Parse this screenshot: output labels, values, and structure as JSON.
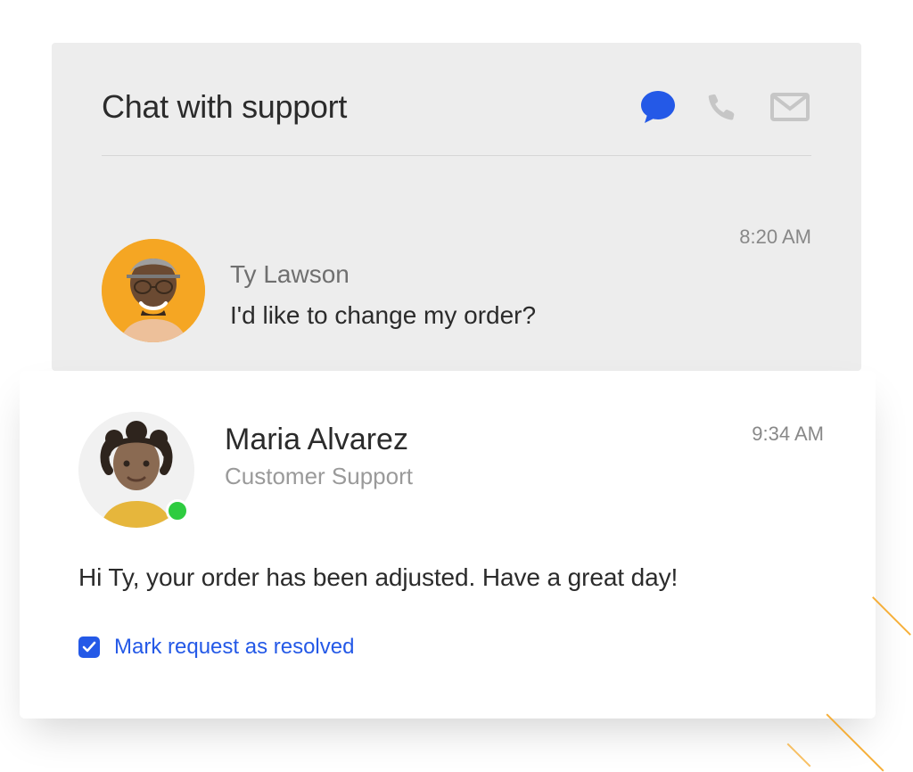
{
  "header": {
    "title": "Chat with support",
    "icons": {
      "chat": {
        "name": "chat-bubble-icon",
        "active": true,
        "color": "#2459e7"
      },
      "phone": {
        "name": "phone-icon",
        "active": false,
        "color": "#c6c6c6"
      },
      "mail": {
        "name": "mail-icon",
        "active": false,
        "color": "#c6c6c6"
      }
    }
  },
  "customer_message": {
    "sender_name": "Ty Lawson",
    "text": "I'd like to change my order?",
    "timestamp": "8:20 AM",
    "avatar": {
      "bg_color": "#f5a623",
      "alt": "customer-avatar"
    }
  },
  "agent_reply": {
    "agent_name": "Maria Alvarez",
    "agent_role": "Customer Support",
    "timestamp": "9:34 AM",
    "text": "Hi Ty, your order has been adjusted. Have a great day!",
    "presence": {
      "online": true,
      "color": "#2ecc40"
    },
    "avatar": {
      "bg_color": "#efefef",
      "alt": "agent-avatar"
    }
  },
  "resolve": {
    "checked": true,
    "label": "Mark request as resolved",
    "color": "#2459e7"
  }
}
